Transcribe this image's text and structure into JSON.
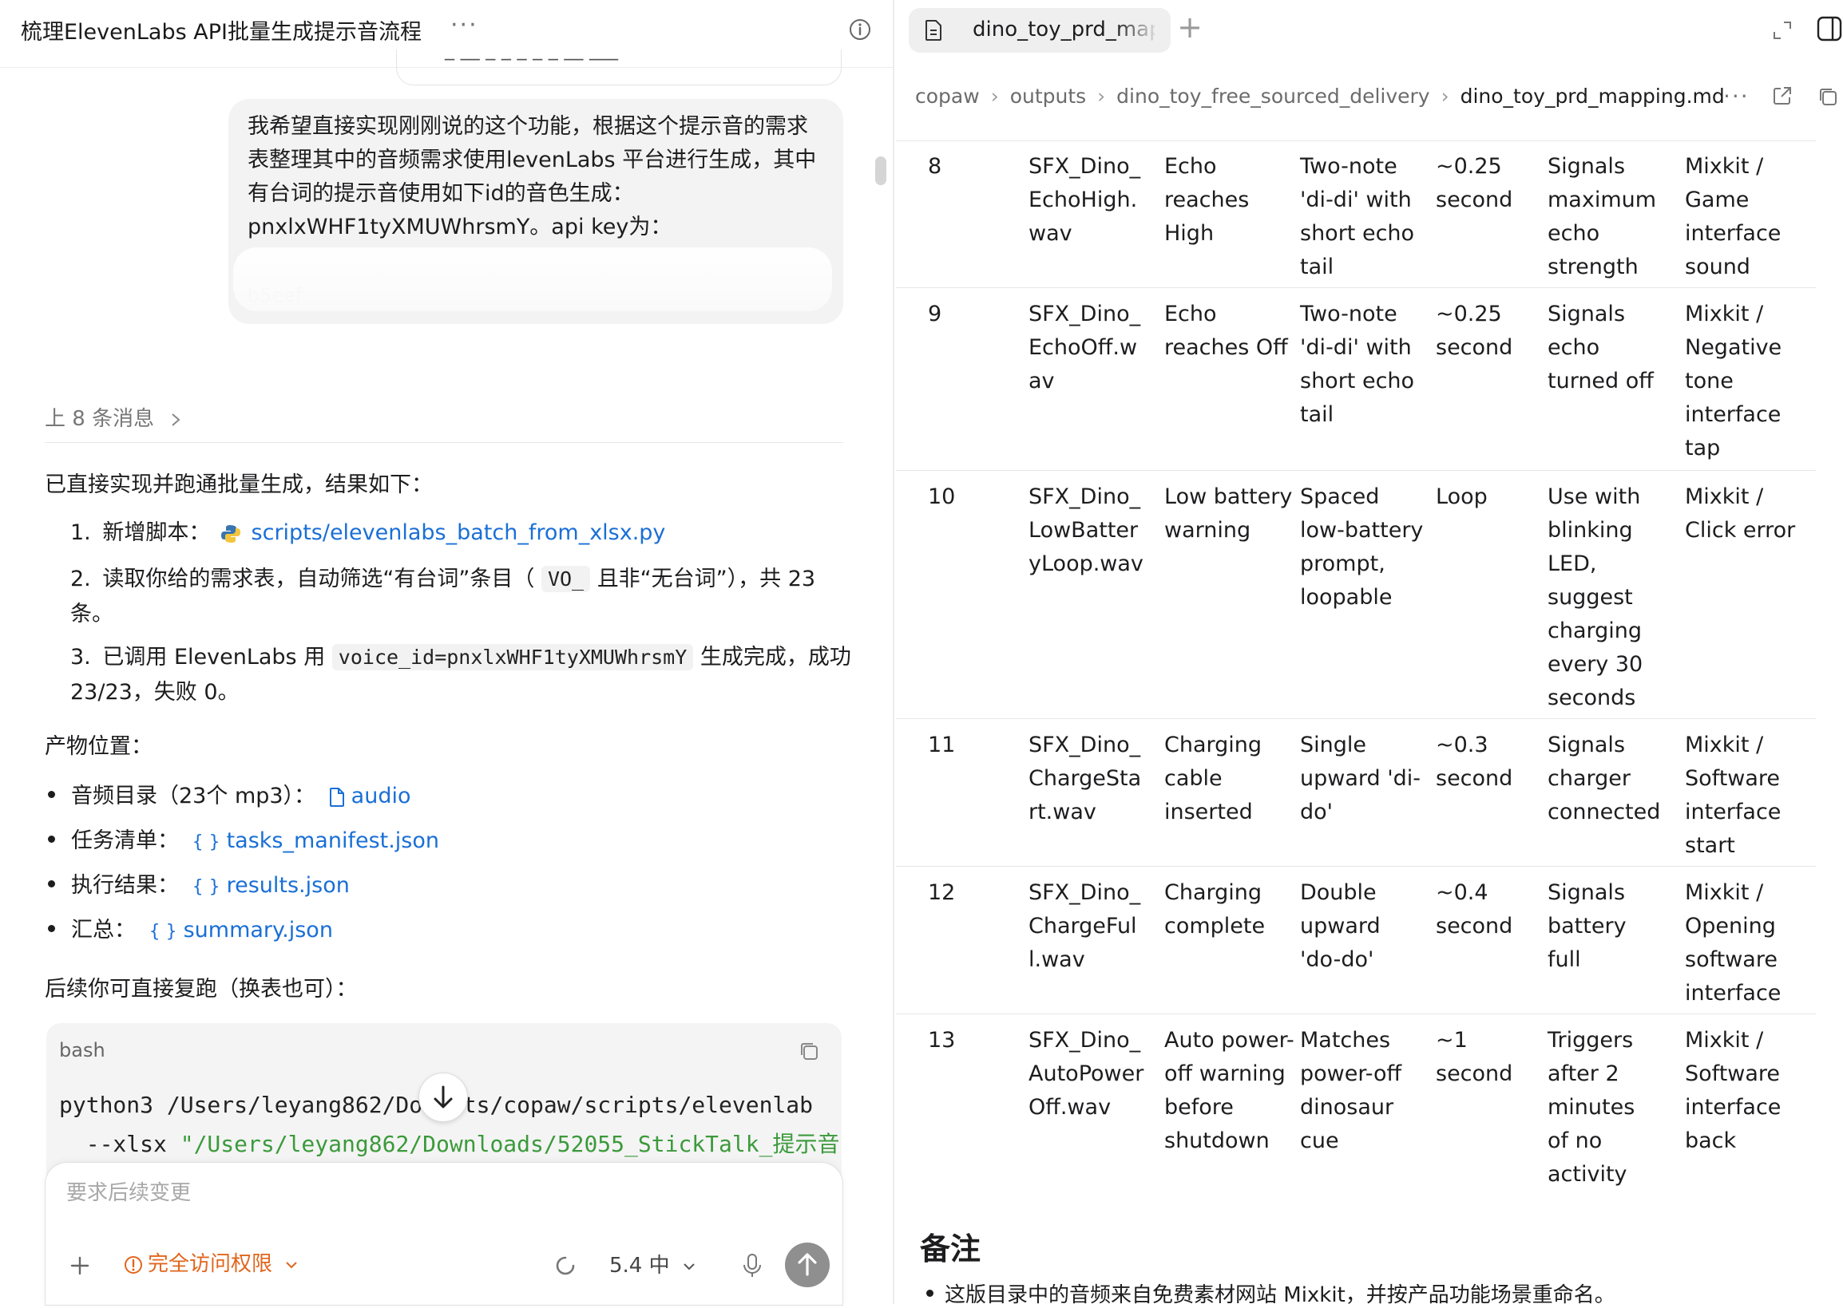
{
  "left": {
    "title": "梳理ElevenLabs API批量生成提示音流程",
    "more": "···",
    "prev_bubble_stub": "_ __ _ _ _ _ _ __ ___",
    "user_message": "我希望直接实现刚刚说的这个功能，根据这个提示音的需求表整理其中的音频需求使用levenLabs 平台进行生成，其中有台词的提示音使用如下id的音色生成：pnxlxWHF1tyXMUWhrsmY。api key为：",
    "user_message_peek": "b5eef",
    "prev_messages_label": "上 8 条消息",
    "assistant": {
      "intro": "已直接实现并跑通批量生成，结果如下：",
      "steps": [
        {
          "num": "1.",
          "prefix": "新增脚本：",
          "link": "scripts/elevenlabs_batch_from_xlsx.py"
        },
        {
          "num": "2.",
          "text_a": "读取你给的需求表，自动筛选“有台词”条目（",
          "code": "VO_",
          "text_b": "且非“无台词”），共 23 条。"
        },
        {
          "num": "3.",
          "text_a": "已调用 ElevenLabs 用",
          "code": "voice_id=pnxlxWHF1tyXMUWhrsmY",
          "text_b": "生成完成，成功 23/23，失败 0。"
        }
      ],
      "outputs_label": "产物位置：",
      "outputs": [
        {
          "label": "音频目录（23个 mp3）：",
          "icon": "file-icon",
          "link": "audio"
        },
        {
          "label": "任务清单：",
          "icon": "json-icon",
          "link": "tasks_manifest.json"
        },
        {
          "label": "执行结果：",
          "icon": "json-icon",
          "link": "results.json"
        },
        {
          "label": "汇总：",
          "icon": "json-icon",
          "link": "summary.json"
        }
      ],
      "rerun_label": "后续你可直接复跑（换表也可）：",
      "code_lang": "bash",
      "code_line1": "python3 /Users/leyang862/Do  ents/copaw/scripts/elevenlab",
      "code_line2_pre": "  --xlsx ",
      "code_line2_str": "\"/Users/leyang862/Downloads/52055_StickTalk_提示音"
    },
    "composer": {
      "placeholder": "要求后续变更",
      "permission": "完全访问权限",
      "model": "5.4 中"
    }
  },
  "right": {
    "tab_label": "dino_toy_prd_mapping.md",
    "new_tab": "+",
    "breadcrumb": [
      "copaw",
      "outputs",
      "dino_toy_free_sourced_delivery",
      "dino_toy_prd_mapping.md"
    ],
    "breadcrumb_more": "···",
    "table_rows": [
      {
        "no": "8",
        "file": "SFX_Dino_EchoHigh.wav",
        "event": "Echo reaches High",
        "sound": "Two-note 'di-di' with short echo tail",
        "duration": "~0.25 second",
        "purpose": "Signals maximum echo strength",
        "source": "Mixkit / Game interface sound"
      },
      {
        "no": "9",
        "file": "SFX_Dino_EchoOff.wav",
        "event": "Echo reaches Off",
        "sound": "Two-note 'di-di' with short echo tail",
        "duration": "~0.25 second",
        "purpose": "Signals echo turned off",
        "source": "Mixkit / Negative tone interface tap"
      },
      {
        "no": "10",
        "file": "SFX_Dino_LowBatteryLoop.wav",
        "event": "Low battery warning",
        "sound": "Spaced low-battery prompt, loopable",
        "duration": "Loop",
        "purpose": "Use with blinking LED, suggest charging every 30 seconds",
        "source": "Mixkit / Click error"
      },
      {
        "no": "11",
        "file": "SFX_Dino_ChargeStart.wav",
        "event": "Charging cable inserted",
        "sound": "Single upward 'di-do'",
        "duration": "~0.3 second",
        "purpose": "Signals charger connected",
        "source": "Mixkit / Software interface start"
      },
      {
        "no": "12",
        "file": "SFX_Dino_ChargeFull.wav",
        "event": "Charging complete",
        "sound": "Double upward 'do-do'",
        "duration": "~0.4 second",
        "purpose": "Signals battery full",
        "source": "Mixkit / Opening software interface"
      },
      {
        "no": "13",
        "file": "SFX_Dino_AutoPowerOff.wav",
        "event": "Auto power-off warning before shutdown",
        "sound": "Matches power-off dinosaur cue",
        "duration": "~1 second",
        "purpose": "Triggers after 2 minutes of no activity",
        "source": "Mixkit / Software interface back"
      }
    ],
    "notes_heading": "备注",
    "notes_item": "这版目录中的音频来自免费素材网站 Mixkit，并按产品功能场景重命名。"
  },
  "colors": {
    "link": "#1a6fd6",
    "permission_accent": "#e0661d",
    "code_string": "#3b9a3b",
    "send_button": "#8f8f8f"
  }
}
